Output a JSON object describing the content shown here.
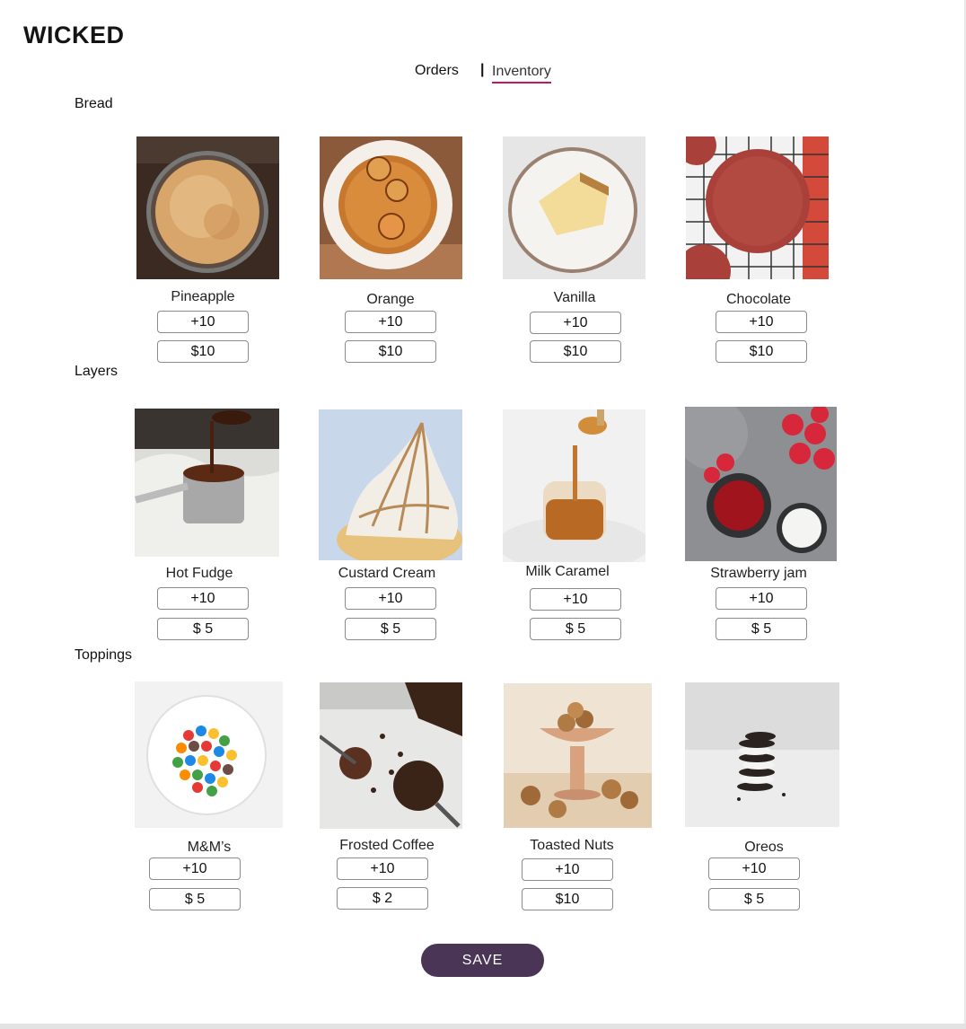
{
  "brand": {
    "logo_text": "WICKED"
  },
  "nav": {
    "orders": "Orders",
    "separator": "|",
    "inventory": "Inventory"
  },
  "sections": [
    {
      "title": "Bread",
      "items": [
        {
          "name": "Pineapple",
          "qty": "+10",
          "price": "$10"
        },
        {
          "name": "Orange",
          "qty": "+10",
          "price": "$10"
        },
        {
          "name": "Vanilla",
          "qty": "+10",
          "price": "$10"
        },
        {
          "name": "Chocolate",
          "qty": "+10",
          "price": "$10"
        }
      ]
    },
    {
      "title": "Layers",
      "items": [
        {
          "name": "Hot Fudge",
          "qty": "+10",
          "price": "$ 5"
        },
        {
          "name": "Custard Cream",
          "qty": "+10",
          "price": "$ 5"
        },
        {
          "name": "Milk Caramel",
          "qty": "+10",
          "price": "$ 5"
        },
        {
          "name": "Strawberry jam",
          "qty": "+10",
          "price": "$ 5"
        }
      ]
    },
    {
      "title": "Toppings",
      "items": [
        {
          "name": "M&M’s",
          "qty": "+10",
          "price": "$ 5"
        },
        {
          "name": "Frosted Coffee",
          "qty": "+10",
          "price": "$ 2"
        },
        {
          "name": "Toasted Nuts",
          "qty": "+10",
          "price": "$10"
        },
        {
          "name": "Oreos",
          "qty": "+10",
          "price": "$ 5"
        }
      ]
    }
  ],
  "save_label": "SAVE",
  "colors": {
    "accent": "#c2185b",
    "save_button": "#4a3556",
    "logo_mark": "#c8102e"
  }
}
